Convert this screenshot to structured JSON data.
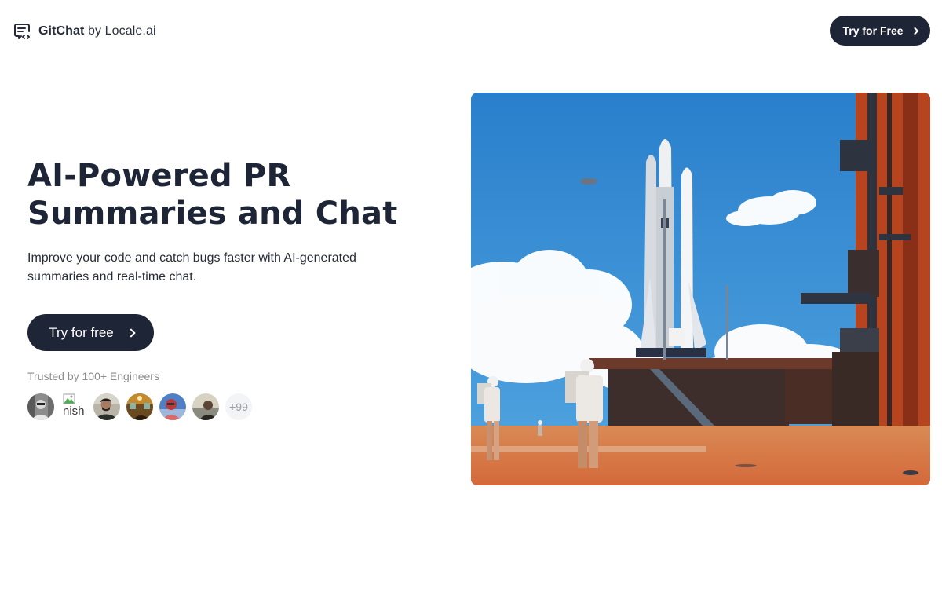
{
  "nav": {
    "brand_name": "GitChat",
    "brand_suffix": " by Locale.ai",
    "brand_icon": "chat-code-icon",
    "cta_label": "Try for Free",
    "cta_icon": "chevron-right-icon"
  },
  "hero": {
    "title": "AI-Powered PR Summaries and Chat",
    "subtitle": "Improve your code and catch bugs faster with AI-generated summaries and real-time chat.",
    "cta_label": "Try for free",
    "cta_icon": "chevron-right-icon",
    "trusted_text": "Trusted by 100+ Engineers",
    "avatars": [
      {
        "type": "photo",
        "alt": "engineer avatar 1"
      },
      {
        "type": "broken-image",
        "alt": "nish"
      },
      {
        "type": "photo",
        "alt": "engineer avatar 3"
      },
      {
        "type": "photo",
        "alt": "engineer avatar 4"
      },
      {
        "type": "photo",
        "alt": "engineer avatar 5"
      },
      {
        "type": "photo",
        "alt": "engineer avatar 6"
      }
    ],
    "more_count": "+99",
    "image_alt": "Astronauts in front of a rocket on an orange desert launch pad"
  },
  "colors": {
    "primary": "#1e2537",
    "text_muted": "#8a8d93",
    "sky": "#2f86d0",
    "desert": "#d8743e",
    "tower": "#b8431f"
  }
}
